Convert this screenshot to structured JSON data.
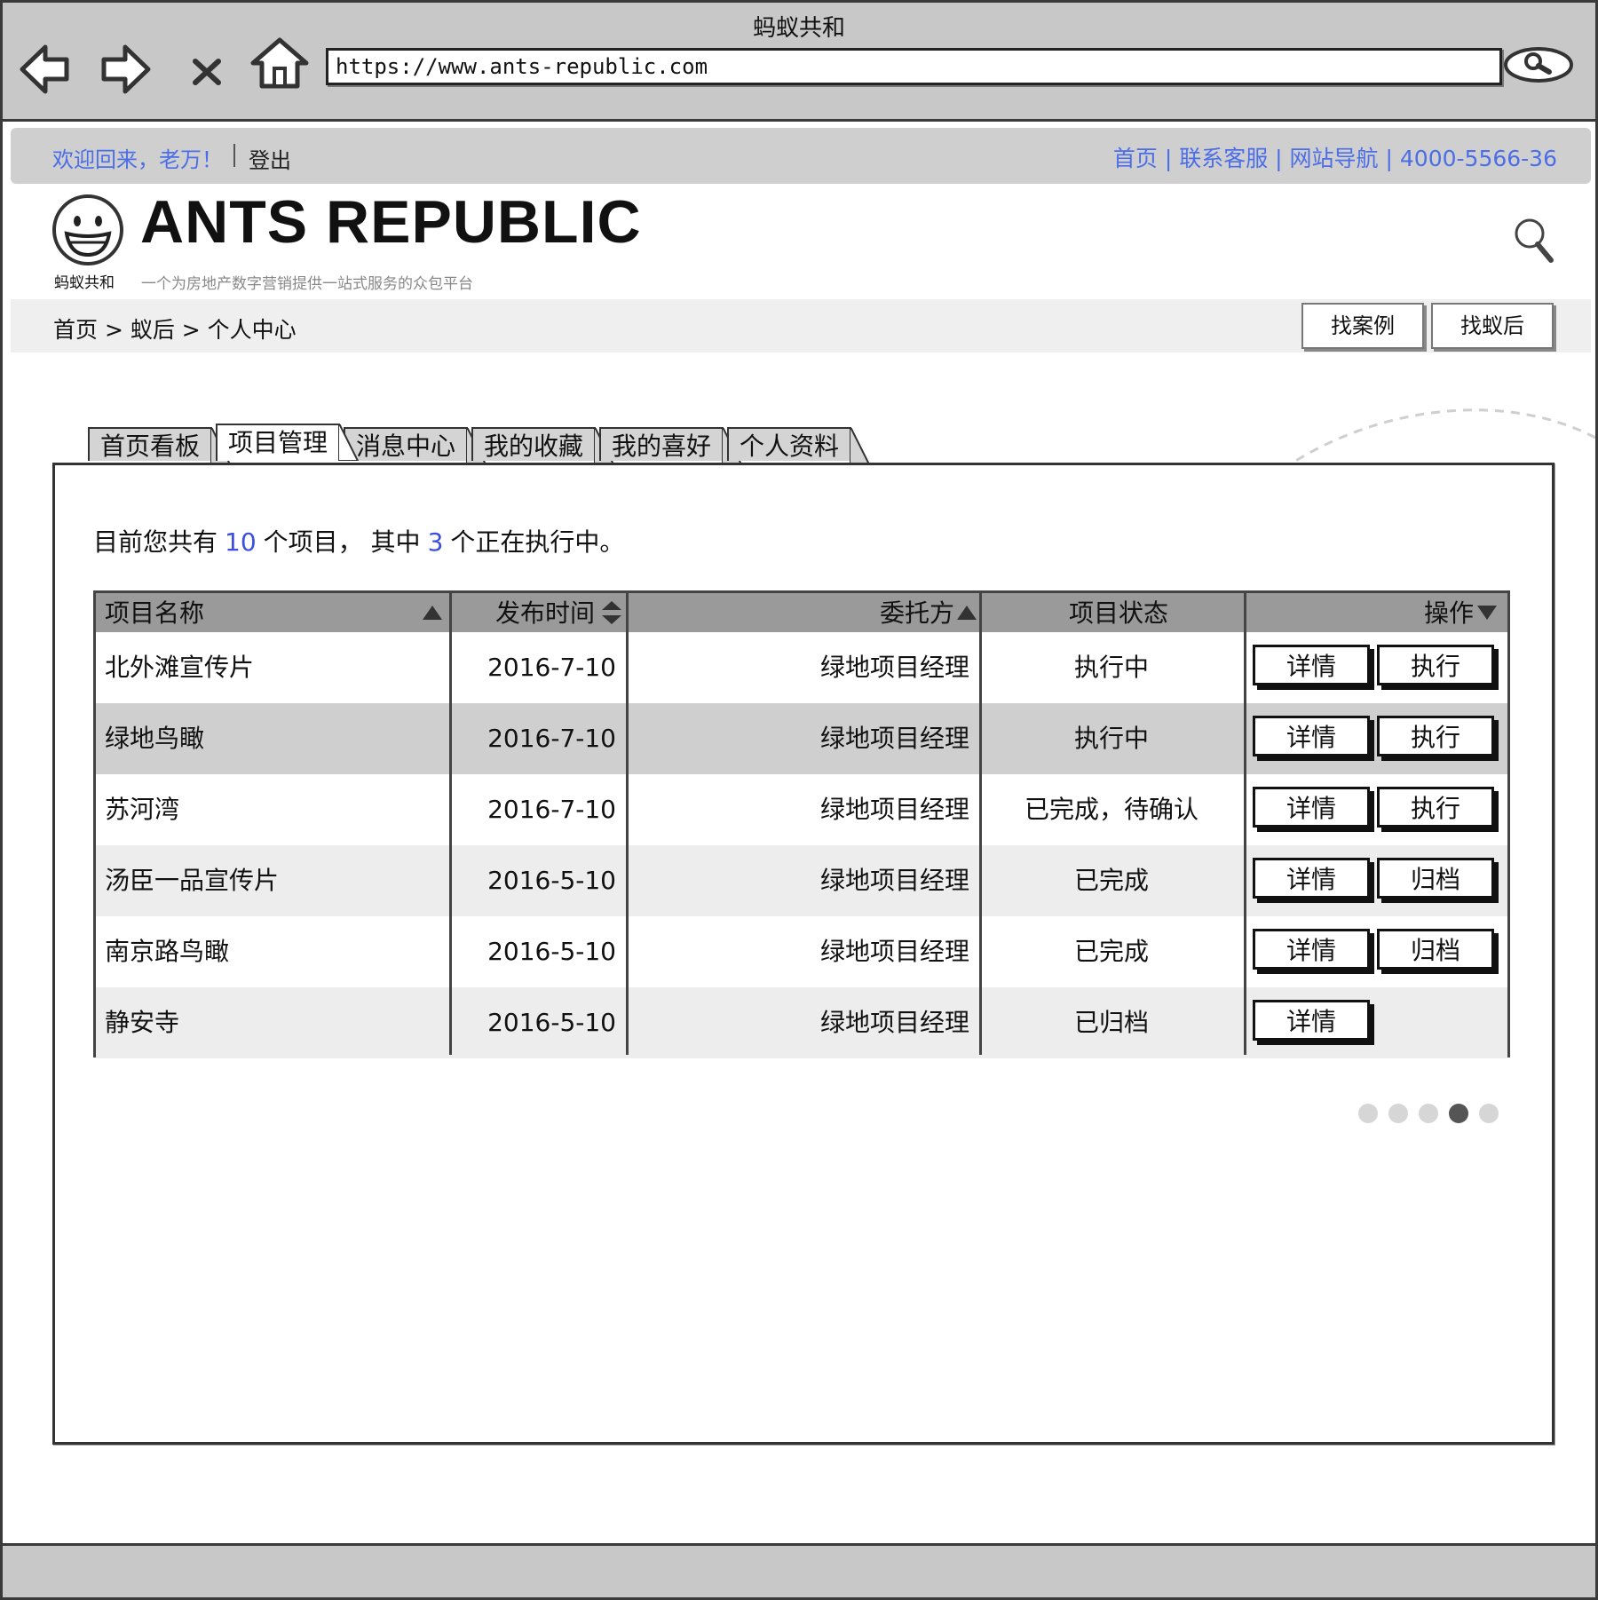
{
  "browser": {
    "title": "蚂蚁共和",
    "url": "https://www.ants-republic.com",
    "icons": [
      "back-arrow-icon",
      "forward-arrow-icon",
      "stop-icon",
      "home-icon",
      "search-icon"
    ]
  },
  "topbar": {
    "welcome": "欢迎回来，老万！",
    "logout": "登出",
    "links": [
      "首页",
      "联系客服",
      "网站导航",
      "4000-5566-36"
    ],
    "separator": " | ",
    "link_color": "#4b6ee8"
  },
  "header": {
    "logo_small": "蚂蚁共和",
    "brand": "ANTS REPUBLIC",
    "slogan": "一个为房地产数字营销提供一站式服务的众包平台"
  },
  "breadcrumb": {
    "path": "首页 > 蚁后 > 个人中心",
    "buttons": [
      "找案例",
      "找蚁后"
    ]
  },
  "tabs": [
    "首页看板",
    "项目管理",
    "消息中心",
    "我的收藏",
    "我的喜好",
    "个人资料"
  ],
  "active_tab": "项目管理",
  "summary": {
    "prefix": "目前您共有",
    "total": "10",
    "middle": "个项目，  其中",
    "running": "3",
    "suffix": "个正在执行中。",
    "number_color": "#3c4fe0"
  },
  "table": {
    "headers": [
      "项目名称",
      "发布时间",
      "委托方",
      "项目状态",
      "操作"
    ],
    "sort_icons": [
      "sort-asc-icon",
      "sort-both-icon",
      "sort-asc-icon",
      "",
      "sort-desc-icon"
    ],
    "rows": [
      {
        "name": "北外滩宣传片",
        "date": "2016-7-10",
        "client": "绿地项目经理",
        "status": "执行中",
        "actions": [
          "详情",
          "执行"
        ]
      },
      {
        "name": "绿地鸟瞰",
        "date": "2016-7-10",
        "client": "绿地项目经理",
        "status": "执行中",
        "actions": [
          "详情",
          "执行"
        ]
      },
      {
        "name": "苏河湾",
        "date": "2016-7-10",
        "client": "绿地项目经理",
        "status": "已完成，待确认",
        "actions": [
          "详情",
          "执行"
        ]
      },
      {
        "name": "汤臣一品宣传片",
        "date": "2016-5-10",
        "client": "绿地项目经理",
        "status": "已完成",
        "actions": [
          "详情",
          "归档"
        ]
      },
      {
        "name": "南京路鸟瞰",
        "date": "2016-5-10",
        "client": "绿地项目经理",
        "status": "已完成",
        "actions": [
          "详情",
          "归档"
        ]
      },
      {
        "name": "静安寺",
        "date": "2016-5-10",
        "client": "绿地项目经理",
        "status": "已归档",
        "actions": [
          "详情"
        ]
      }
    ],
    "row_colors": [
      "#ffffff",
      "#cfcfcf",
      "#ffffff",
      "#ededed",
      "#ffffff",
      "#ededed"
    ]
  },
  "pagination": {
    "count": 5,
    "active_page": 4
  }
}
